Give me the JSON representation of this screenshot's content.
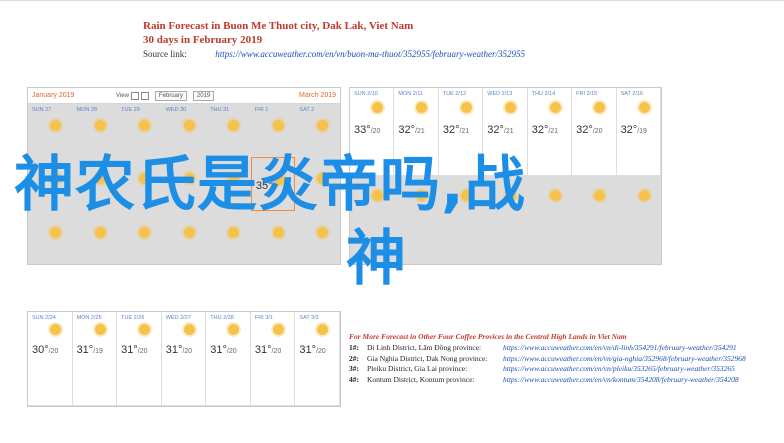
{
  "header": {
    "title": "Rain Forecast in Buon Me Thuot city, Dak Lak, Viet Nam",
    "subtitle": "30 days in February 2019",
    "source_label": "Source link:",
    "source_url": "https://www.accuweather.com/en/vn/buon-ma-thuot/352955/february-weather/352955"
  },
  "calendar_top_left": {
    "prev_month": "January 2019",
    "view_label": "View",
    "month_select": "February",
    "year_select": "2019",
    "next_month": "March 2019",
    "rows": [
      {
        "days": [
          "SUN 27",
          "MON 28",
          "TUE 29",
          "WED 30",
          "THU 31",
          "FRI 1",
          "SAT 2"
        ]
      },
      {
        "days": [
          "",
          "",
          "",
          "",
          "",
          "",
          ""
        ]
      },
      {
        "days": [
          "",
          "",
          "",
          "",
          "",
          "",
          ""
        ]
      }
    ],
    "today_temp": "35°",
    "sample_temps": [
      "",
      ""
    ]
  },
  "calendar_top_right": {
    "day_labels": [
      "SUN 2/10",
      "MON 2/11",
      "TUE 2/12",
      "WED 2/13",
      "THU 2/14",
      "FRI 2/15",
      "SAT 2/16"
    ],
    "temps": [
      "33°",
      "32°",
      "32°",
      "32°",
      "32°",
      "32°",
      "32°"
    ],
    "lows": [
      "/20",
      "/21",
      "/21",
      "/21",
      "/21",
      "/20",
      "/19"
    ]
  },
  "calendar_bottom": {
    "day_labels": [
      "SUN 2/24",
      "MON 2/25",
      "TUE 2/26",
      "WED 2/27",
      "THU 2/28",
      "FRI 3/1",
      "SAT 3/2"
    ],
    "temps": [
      "30°",
      "31°",
      "31°",
      "31°",
      "31°",
      "31°",
      "31°"
    ],
    "lows": [
      "/20",
      "/19",
      "/20",
      "/20",
      "/20",
      "/20",
      "/20"
    ]
  },
  "forecast": {
    "title": "For More Forecast in Other Four Coffee Provices in the Central High Lands in Viet Nam",
    "items": [
      {
        "num": "1#:",
        "name": "Di Linh District, Lâm Đồng province:",
        "url": "https://www.accuweather.com/en/vn/di-linh/354291/february-weather/354291"
      },
      {
        "num": "2#:",
        "name": "Gia Nghia District, Dak Nong province:",
        "url": "https://www.accuweather.com/en/vn/gia-nghia/352968/february-weather/352968"
      },
      {
        "num": "3#:",
        "name": "Pleiku District, Gia Lai province:",
        "url": "https://www.accuweather.com/en/vn/pleiku/353265/february-weather/353265"
      },
      {
        "num": "4#:",
        "name": "Kontum District, Kontum province:",
        "url": "https://www.accuweather.com/en/vn/kontum/354208/february-weather/354208"
      }
    ]
  },
  "overlay": {
    "line1": "神农氏是炎帝吗,战",
    "line2": "神"
  }
}
